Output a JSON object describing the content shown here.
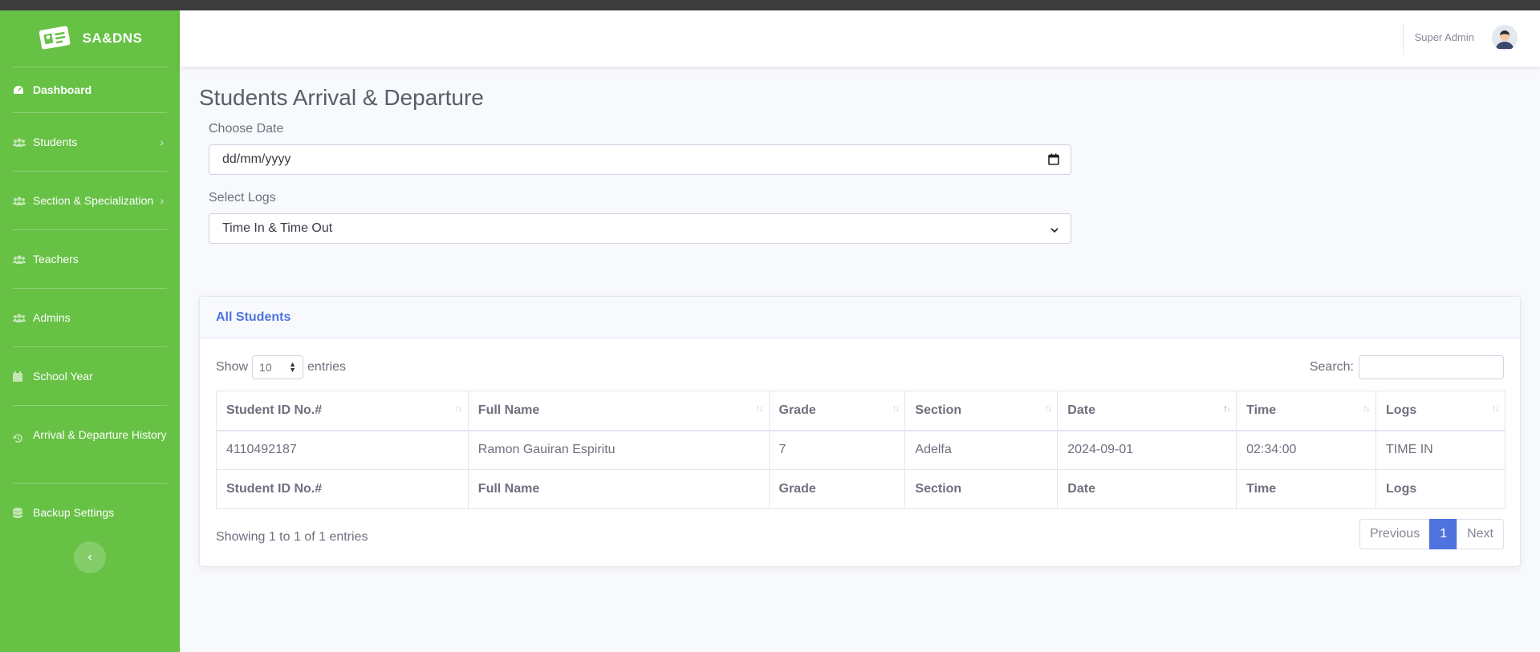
{
  "app": {
    "brand": "SA&DNS"
  },
  "sidebar": {
    "items": [
      {
        "label": "Dashboard",
        "icon": "tachometer-icon"
      },
      {
        "label": "Students",
        "icon": "users-icon"
      },
      {
        "label": "Section & Specialization",
        "icon": "users-icon"
      },
      {
        "label": "Teachers",
        "icon": "users-icon"
      },
      {
        "label": "Admins",
        "icon": "users-icon"
      },
      {
        "label": "School Year",
        "icon": "calendar-icon"
      },
      {
        "label": "Arrival & Departure History",
        "icon": "history-icon"
      },
      {
        "label": "Backup Settings",
        "icon": "database-icon"
      }
    ],
    "toggle_icon": "‹"
  },
  "topbar": {
    "user_name": "Super Admin"
  },
  "page": {
    "title": "Students Arrival & Departure",
    "date_label": "Choose Date",
    "date_placeholder": "dd/mm/yyyy",
    "logs_label": "Select Logs",
    "logs_selected": "Time In & Time Out"
  },
  "card": {
    "title": "All Students",
    "show_label": "Show",
    "entries_label": "entries",
    "page_length": "10",
    "search_label": "Search:",
    "columns": [
      "Student ID No.#",
      "Full Name",
      "Grade",
      "Section",
      "Date",
      "Time",
      "Logs"
    ],
    "rows": [
      [
        "4110492187",
        "Ramon Gauiran Espiritu",
        "7",
        "Adelfa",
        "2024-09-01",
        "02:34:00",
        "TIME IN"
      ]
    ],
    "info": "Showing 1 to 1 of 1 entries",
    "pagination": {
      "previous": "Previous",
      "current": "1",
      "next": "Next"
    }
  },
  "colors": {
    "sidebar": "#66c144",
    "accent": "#4e73df"
  }
}
